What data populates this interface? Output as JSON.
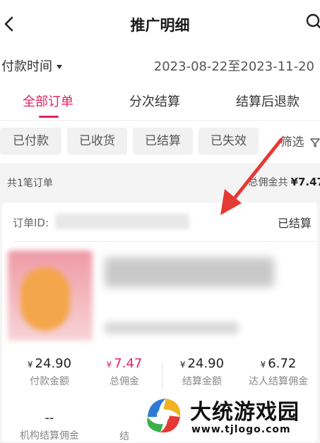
{
  "header": {
    "title": "推广明细",
    "back_icon": "chevron-left-icon",
    "search_icon": "search-icon"
  },
  "filter": {
    "pay_time_label": "付款时间",
    "date_range": "2023-08-22至2023-11-20"
  },
  "tabs": [
    {
      "label": "全部订单",
      "active": true
    },
    {
      "label": "分次结算",
      "active": false
    },
    {
      "label": "结算后退款",
      "active": false
    }
  ],
  "chips": [
    "已付款",
    "已收货",
    "已结算",
    "已失效"
  ],
  "screen_label": "筛选",
  "summary": {
    "count_text": "共1笔订单",
    "total_label": "总佣金共",
    "total_value": "¥7.47"
  },
  "order": {
    "id_label": "订单ID:",
    "status": "已结算",
    "stats": [
      {
        "value": "24.90",
        "label": "付款金额"
      },
      {
        "value": "7.47",
        "label": "总佣金"
      },
      {
        "value": "24.90",
        "label": "结算金额"
      },
      {
        "value": "6.72",
        "label": "达人结算佣金"
      }
    ],
    "row2": [
      {
        "value": "--",
        "label": "机构结算佣金"
      },
      {
        "value": "",
        "label": "结"
      }
    ]
  },
  "watermark": {
    "title": "大统游戏园",
    "url": "www.tjlogo.com"
  },
  "colors": {
    "accent": "#e0245e",
    "arrow": "#e53935"
  }
}
